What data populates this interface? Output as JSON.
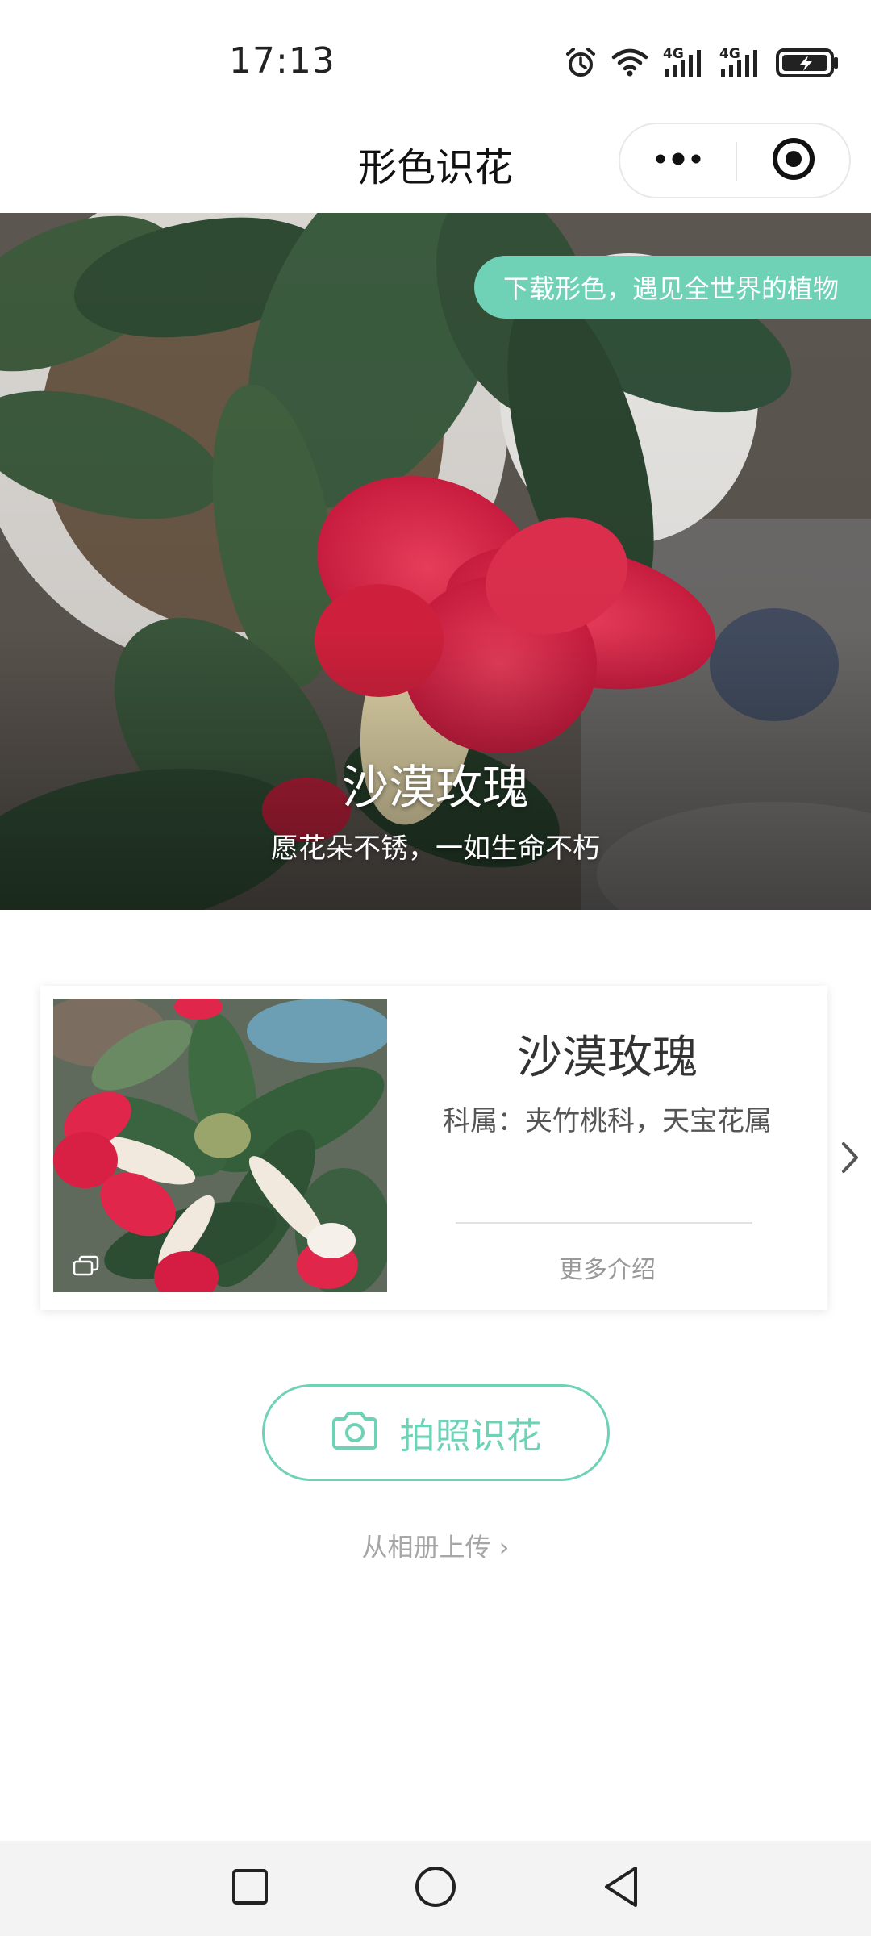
{
  "status_bar": {
    "time": "17:13",
    "icons": [
      "alarm-icon",
      "wifi-icon",
      "4g-signal-icon",
      "4g-signal-icon",
      "battery-charging-icon"
    ],
    "network_labels": [
      "4G",
      "4G"
    ]
  },
  "nav": {
    "title": "形色识花",
    "more_icon": "more-dots-icon",
    "close_icon": "target-close-icon"
  },
  "hero": {
    "badge": "下载形色，遇见全世界的植物",
    "name": "沙漠玫瑰",
    "motto": "愿花朵不锈，一如生命不朽"
  },
  "card": {
    "name": "沙漠玫瑰",
    "family": "科属：夹竹桃科，天宝花属",
    "more": "更多介绍",
    "next_icon": "chevron-right-icon",
    "gallery_icon": "gallery-icon"
  },
  "actions": {
    "photo_button": "拍照识花",
    "photo_icon": "camera-icon",
    "upload_link": "从相册上传 ›"
  },
  "system_nav": {
    "icons": [
      "recent-apps-icon",
      "home-icon",
      "back-icon"
    ]
  },
  "colors": {
    "accent": "#6fd2b6",
    "flower": "#e0264a",
    "leaf": "#3a5a3c"
  }
}
